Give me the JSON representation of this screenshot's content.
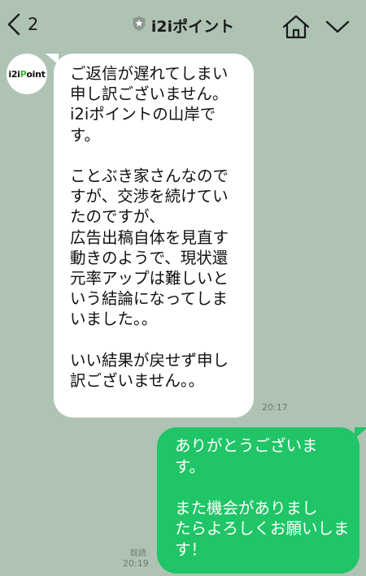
{
  "header": {
    "back_count": "2",
    "title": "i2iポイント"
  },
  "contact": {
    "avatar_prefix": "i2i",
    "avatar_accent": "P",
    "avatar_suffix": "oint"
  },
  "messages": [
    {
      "direction": "incoming",
      "text": "ご返信が遅れてしまい\n申し訳ございません。\ni2iポイントの山岸で\nす。\n\nことぶき家さんなので\nすが、交渉を続けてい\nたのですが、\n広告出稿自体を見直す\n動きのようで、現状還\n元率アップは難しいと\nいう結論になってしま\nいました。。\n\nいい結果が戻せず申し\n訳ございません。。",
      "time": "20:17"
    },
    {
      "direction": "outgoing",
      "text": "ありがとうございま\nす。\n\nまた機会がありまし\nたらよろしくお願いしま\nす！",
      "read_label": "既読",
      "time": "20:19"
    }
  ],
  "colors": {
    "background": "#aec3b3",
    "incoming_bubble": "#ffffff",
    "outgoing_bubble": "#1fc566",
    "avatar_accent": "#3fae3a"
  },
  "icons": {
    "back": "chevron-left-icon",
    "verified": "shield-star-icon",
    "home": "home-icon",
    "menu": "chevron-down-icon"
  }
}
